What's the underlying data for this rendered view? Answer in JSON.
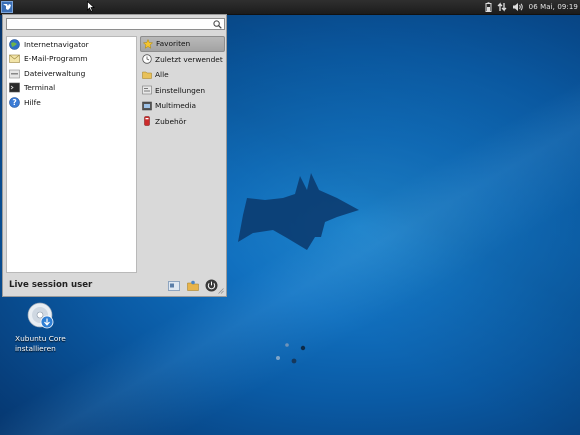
{
  "panel": {
    "clock": "06 Mai, 09:19",
    "icons": [
      "battery-icon",
      "network-icon",
      "volume-icon"
    ]
  },
  "menu": {
    "search": {
      "value": "",
      "placeholder": ""
    },
    "favorites": [
      {
        "label": "Internetnavigator",
        "icon": "web-browser-icon"
      },
      {
        "label": "E-Mail-Programm",
        "icon": "mail-icon"
      },
      {
        "label": "Dateiverwaltung",
        "icon": "file-manager-icon"
      },
      {
        "label": "Terminal",
        "icon": "terminal-icon"
      },
      {
        "label": "Hilfe",
        "icon": "help-icon"
      }
    ],
    "categories": [
      {
        "label": "Favoriten",
        "icon": "star-icon",
        "active": true
      },
      {
        "label": "Zuletzt verwendet",
        "icon": "clock-icon",
        "active": false
      },
      {
        "label": "Alle",
        "icon": "folder-icon",
        "active": false
      },
      {
        "label": "Einstellungen",
        "icon": "settings-icon",
        "active": false
      },
      {
        "label": "Multimedia",
        "icon": "multimedia-icon",
        "active": false
      },
      {
        "label": "Zubehör",
        "icon": "accessories-icon",
        "active": false
      }
    ],
    "user": "Live session user",
    "bottom_buttons": [
      "settings-manager-icon",
      "lock-screen-icon",
      "power-icon"
    ]
  },
  "desktop": {
    "icons": [
      {
        "label_line1": "Xubuntu Core",
        "label_line2": "installieren",
        "icon": "installer-disc-icon"
      }
    ]
  },
  "colors": {
    "panel": "#1e1e1e",
    "menu_bg": "#d9d9d9",
    "active_category": "#a8a8a8",
    "desktop_blue": "#0a5aa4"
  }
}
